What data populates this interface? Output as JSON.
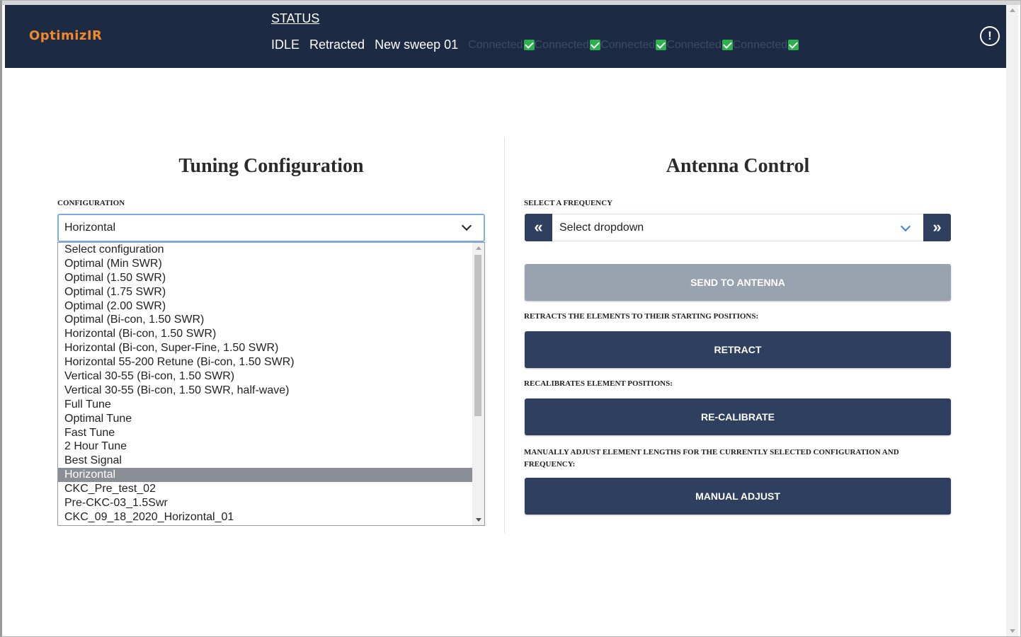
{
  "header": {
    "logo": "OptimizIR",
    "status_title": "STATUS",
    "status_state": "IDLE",
    "status_position": "Retracted",
    "status_sweep": "New sweep 01",
    "connections": [
      "Connected",
      "Connected",
      "Connected",
      "Connected",
      "Connected"
    ],
    "alert_icon": "!"
  },
  "tuning": {
    "title": "Tuning Configuration",
    "config_label": "CONFIGURATION",
    "selected": "Horizontal",
    "options": [
      "Select configuration",
      "Optimal (Min SWR)",
      "Optimal (1.50 SWR)",
      "Optimal (1.75 SWR)",
      "Optimal (2.00 SWR)",
      "Optimal (Bi-con, 1.50 SWR)",
      "Horizontal (Bi-con, 1.50 SWR)",
      "Horizontal (Bi-con, Super-Fine, 1.50 SWR)",
      "Horizontal 55-200 Retune (Bi-con, 1.50 SWR)",
      "Vertical 30-55 (Bi-con, 1.50 SWR)",
      "Vertical 30-55 (Bi-con, 1.50 SWR, half-wave)",
      "Full Tune",
      "Optimal Tune",
      "Fast Tune",
      "2 Hour Tune",
      "Best Signal",
      "Horizontal",
      "CKC_Pre_test_02",
      "Pre-CKC-03_1.5Swr",
      "CKC_09_18_2020_Horizontal_01"
    ]
  },
  "antenna": {
    "title": "Antenna Control",
    "freq_label": "SELECT A FREQUENCY",
    "freq_value": "Select dropdown",
    "prev_icon": "«",
    "next_icon": "»",
    "send_label": "SEND TO ANTENNA",
    "retract_desc": "RETRACTS THE ELEMENTS TO THEIR STARTING POSITIONS:",
    "retract_label": "RETRACT",
    "recal_desc": "RECALIBRATES ELEMENT POSITIONS:",
    "recal_label": "RE-CALIBRATE",
    "manual_desc": "MANUALLY ADJUST ELEMENT LENGTHS FOR THE CURRENTLY SELECTED CONFIGURATION AND FREQUENCY:",
    "manual_label": "MANUAL ADJUST"
  }
}
